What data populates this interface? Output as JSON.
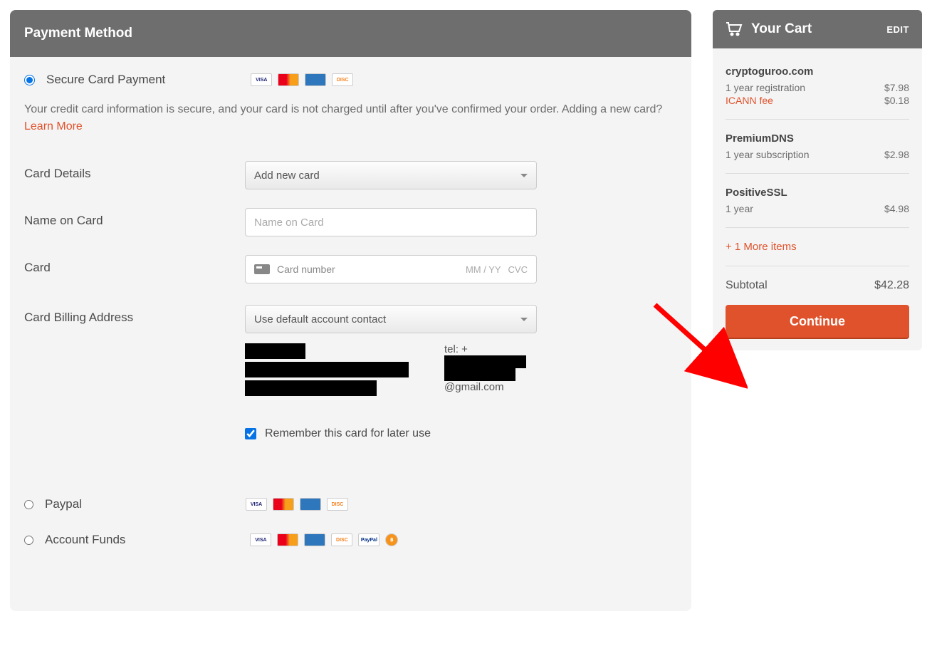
{
  "main": {
    "title": "Payment Method",
    "secure_card": {
      "label": "Secure Card Payment",
      "desc_text": "Your credit card information is secure, and your card is not charged until after you've confirmed your order. Adding a new card? ",
      "learn_more": "Learn More"
    },
    "form": {
      "card_details_label": "Card Details",
      "card_details_value": "Add new card",
      "name_label": "Name on Card",
      "name_placeholder": "Name on Card",
      "card_label": "Card",
      "card_number_placeholder": "Card number",
      "card_exp_placeholder": "MM / YY",
      "card_cvc_placeholder": "CVC",
      "billing_label": "Card Billing Address",
      "billing_value": "Use default account contact",
      "tel_prefix": "tel: +",
      "email_suffix": "@gmail.com",
      "remember_label": "Remember this card for later use"
    },
    "paypal_label": "Paypal",
    "funds_label": "Account Funds"
  },
  "cart": {
    "title": "Your Cart",
    "edit": "EDIT",
    "items": [
      {
        "name": "cryptoguroo.com",
        "lines": [
          {
            "label": "1 year registration",
            "price": "$7.98",
            "fee": false
          },
          {
            "label": "ICANN fee",
            "price": "$0.18",
            "fee": true
          }
        ]
      },
      {
        "name": "PremiumDNS",
        "lines": [
          {
            "label": "1 year subscription",
            "price": "$2.98",
            "fee": false
          }
        ]
      },
      {
        "name": "PositiveSSL",
        "lines": [
          {
            "label": "1 year",
            "price": "$4.98",
            "fee": false
          }
        ]
      }
    ],
    "more": "+ 1 More items",
    "subtotal_label": "Subtotal",
    "subtotal_value": "$42.28",
    "continue": "Continue"
  }
}
